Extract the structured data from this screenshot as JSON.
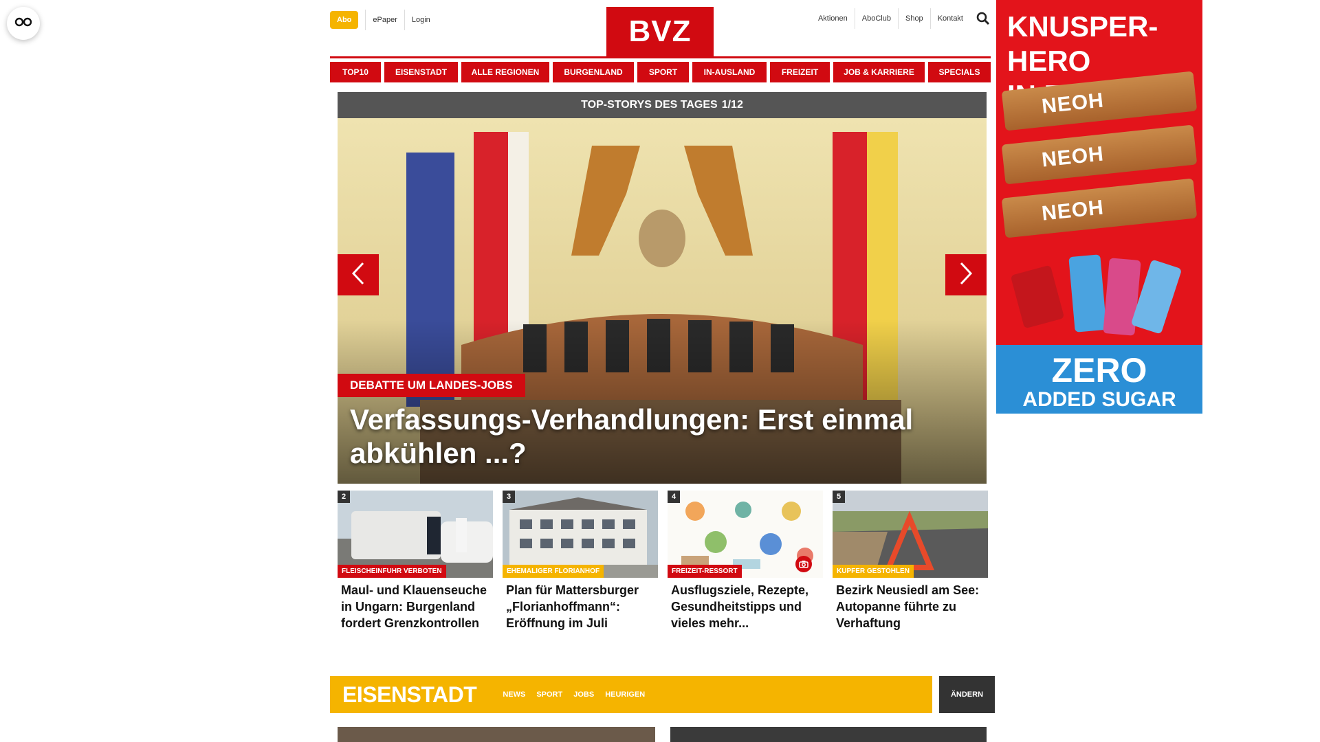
{
  "accessibility": {
    "icon": "glasses-icon"
  },
  "topbar": {
    "abo_label": "Abo",
    "left_links": [
      "ePaper",
      "Login"
    ],
    "right_links": [
      "Aktionen",
      "AboClub",
      "Shop",
      "Kontakt"
    ],
    "search_icon": "search-icon",
    "logo_text": "BVZ"
  },
  "nav": {
    "items": [
      "TOP10",
      "EISENSTADT",
      "ALLE REGIONEN",
      "BURGENLAND",
      "SPORT",
      "IN-AUSLAND",
      "FREIZEIT",
      "JOB & KARRIERE",
      "SPECIALS"
    ]
  },
  "hero": {
    "header_label": "TOP-STORYS DES TAGES",
    "slide_counter": "1/12",
    "kicker": "DEBATTE UM LANDES-JOBS",
    "title": "Verfassungs-Verhandlungen: Erst einmal abkühlen ...?",
    "prev_icon": "chevron-left-icon",
    "next_icon": "chevron-right-icon"
  },
  "teasers": [
    {
      "num": "2",
      "kicker": "FLEISCHEINFUHR VERBOTEN",
      "kicker_color": "red",
      "title": "Maul- und Klauenseuche in Ungarn: Burgenland fordert Grenzkontrollen"
    },
    {
      "num": "3",
      "kicker": "EHEMALIGER FLORIANHOF",
      "kicker_color": "yellow",
      "title": "Plan für Mattersburger „Florianhoffmann“: Eröffnung im Juli"
    },
    {
      "num": "4",
      "kicker": "FREIZEIT-RESSORT",
      "kicker_color": "red",
      "title": "Ausflugsziele, Rezepte, Gesundheitstipps und vieles mehr...",
      "badge_icon": "camera-icon"
    },
    {
      "num": "5",
      "kicker": "KUPFER GESTOHLEN",
      "kicker_color": "yellow",
      "title": "Bezirk Neusiedl am See: Autopanne führte zu Verhaftung"
    }
  ],
  "region": {
    "name": "EISENSTADT",
    "links": [
      "NEWS",
      "SPORT",
      "JOBS",
      "HEURIGEN"
    ],
    "change_label": "ÄNDERN"
  },
  "ad": {
    "headline_line1": "KNUSPER-HERO",
    "headline_line2": "IN ZERO!",
    "bar_label": "NEOH",
    "bottom_line1": "ZERO",
    "bottom_line2": "ADDED SUGAR"
  },
  "colors": {
    "brand_red": "#d10a11",
    "accent_yellow": "#f5b400",
    "dark_gray": "#333333"
  }
}
